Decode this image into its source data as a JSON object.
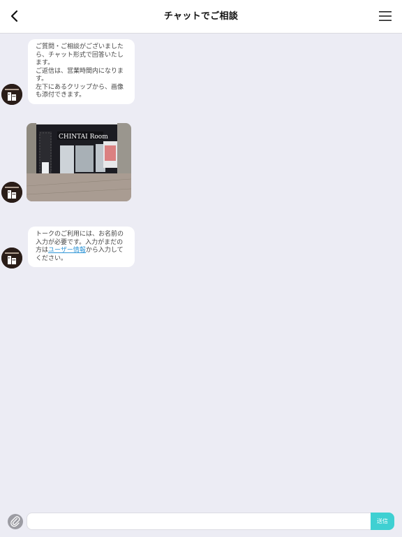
{
  "header": {
    "title": "チャットでご相談",
    "back_icon": "chevron-left-icon",
    "menu_icon": "hamburger-menu-icon"
  },
  "messages": [
    {
      "type": "text",
      "lines": [
        "ご質問・ご相談がございました",
        "ら、チャット形式で回答いたし",
        "ます。",
        "ご返信は、営業時間内になりま",
        "す。",
        "左下にあるクリップから、画像",
        "も添付できます。"
      ]
    },
    {
      "type": "image",
      "sign_text": "CHINTAI Room"
    },
    {
      "type": "text",
      "lines": [
        "トークのご利用には、お名前の",
        "入力が必要です。入力がまだの"
      ],
      "line3_prefix": "方は",
      "line3_link": "ユーザー情報",
      "line3_suffix": "から入力して",
      "line4": "ください。"
    }
  ],
  "composer": {
    "clip_icon": "paperclip-icon",
    "input_value": "",
    "input_placeholder": "",
    "send_label": "送信"
  },
  "colors": {
    "background": "#ececf4",
    "send_button": "#3fd0d2",
    "link": "#2f95d6"
  }
}
